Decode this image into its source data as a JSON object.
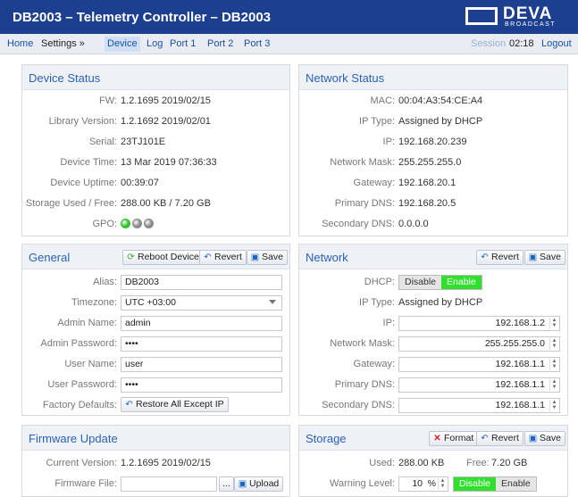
{
  "header": {
    "title": "DB2003 – Telemetry Controller – DB2003",
    "logo_name": "DEVA",
    "logo_sub": "BROADCAST"
  },
  "nav": {
    "items": [
      "Home",
      "Settings »",
      "Device",
      "Log",
      "Port 1",
      "Port 2",
      "Port 3"
    ],
    "session_label": "Session",
    "session_time": "02:18",
    "logout": "Logout"
  },
  "device_status": {
    "title": "Device Status",
    "rows": [
      {
        "label": "FW:",
        "value": "1.2.1695 2019/02/15"
      },
      {
        "label": "Library Version:",
        "value": "1.2.1692 2019/02/01"
      },
      {
        "label": "Serial:",
        "value": "23TJ101E"
      },
      {
        "label": "Device Time:",
        "value": "13 Mar 2019 07:36:33"
      },
      {
        "label": "Device Uptime:",
        "value": "00:39:07"
      },
      {
        "label": "Storage Used / Free:",
        "value": "288.00 KB / 7.20 GB"
      },
      {
        "label": "GPO:",
        "value": ""
      }
    ],
    "gpo_colors": [
      "#33c12f",
      "#8a8a8a",
      "#8a8a8a"
    ]
  },
  "network_status": {
    "title": "Network Status",
    "rows": [
      {
        "label": "MAC:",
        "value": "00:04:A3:54:CE:A4"
      },
      {
        "label": "IP Type:",
        "value": "Assigned by DHCP"
      },
      {
        "label": "IP:",
        "value": "192.168.20.239"
      },
      {
        "label": "Network Mask:",
        "value": "255.255.255.0"
      },
      {
        "label": "Gateway:",
        "value": "192.168.20.1"
      },
      {
        "label": "Primary DNS:",
        "value": "192.168.20.5"
      },
      {
        "label": "Secondary DNS:",
        "value": "0.0.0.0"
      }
    ]
  },
  "general": {
    "title": "General",
    "reboot": "Reboot Device",
    "revert": "Revert",
    "save": "Save",
    "alias_label": "Alias:",
    "alias": "DB2003",
    "timezone_label": "Timezone:",
    "timezone": "UTC +03:00",
    "admin_name_label": "Admin Name:",
    "admin_name": "admin",
    "admin_password_label": "Admin Password:",
    "admin_password": "••••",
    "user_name_label": "User Name:",
    "user_name": "user",
    "user_password_label": "User Password:",
    "user_password": "••••",
    "factory_label": "Factory Defaults:",
    "restore": "Restore All Except IP"
  },
  "network": {
    "title": "Network",
    "revert": "Revert",
    "save": "Save",
    "dhcp_label": "DHCP:",
    "dhcp_off": "Disable",
    "dhcp_on": "Enable",
    "iptype_label": "IP Type:",
    "iptype": "Assigned by DHCP",
    "ip_label": "IP:",
    "ip": "192.168.1.2",
    "mask_label": "Network Mask:",
    "mask": "255.255.255.0",
    "gw_label": "Gateway:",
    "gw": "192.168.1.1",
    "pdns_label": "Primary DNS:",
    "pdns": "192.168.1.1",
    "sdns_label": "Secondary DNS:",
    "sdns": "192.168.1.1"
  },
  "firmware": {
    "title": "Firmware Update",
    "current_label": "Current Version:",
    "current": "1.2.1695 2019/02/15",
    "file_label": "Firmware File:",
    "browse": "...",
    "upload": "Upload"
  },
  "storage": {
    "title": "Storage",
    "format": "Format",
    "revert": "Revert",
    "save": "Save",
    "used_label": "Used:",
    "used": "288.00 KB",
    "free_label": "Free:",
    "free": "7.20 GB",
    "warning_label": "Warning Level:",
    "warning": "10",
    "unit": "%",
    "toggle_on": "Disable",
    "toggle_off": "Enable"
  },
  "colors": {
    "header_bg": "#1d3f8f",
    "link": "#1d4fa8",
    "panel_title": "#2a61b8",
    "toggle_active": "#31e02f"
  }
}
